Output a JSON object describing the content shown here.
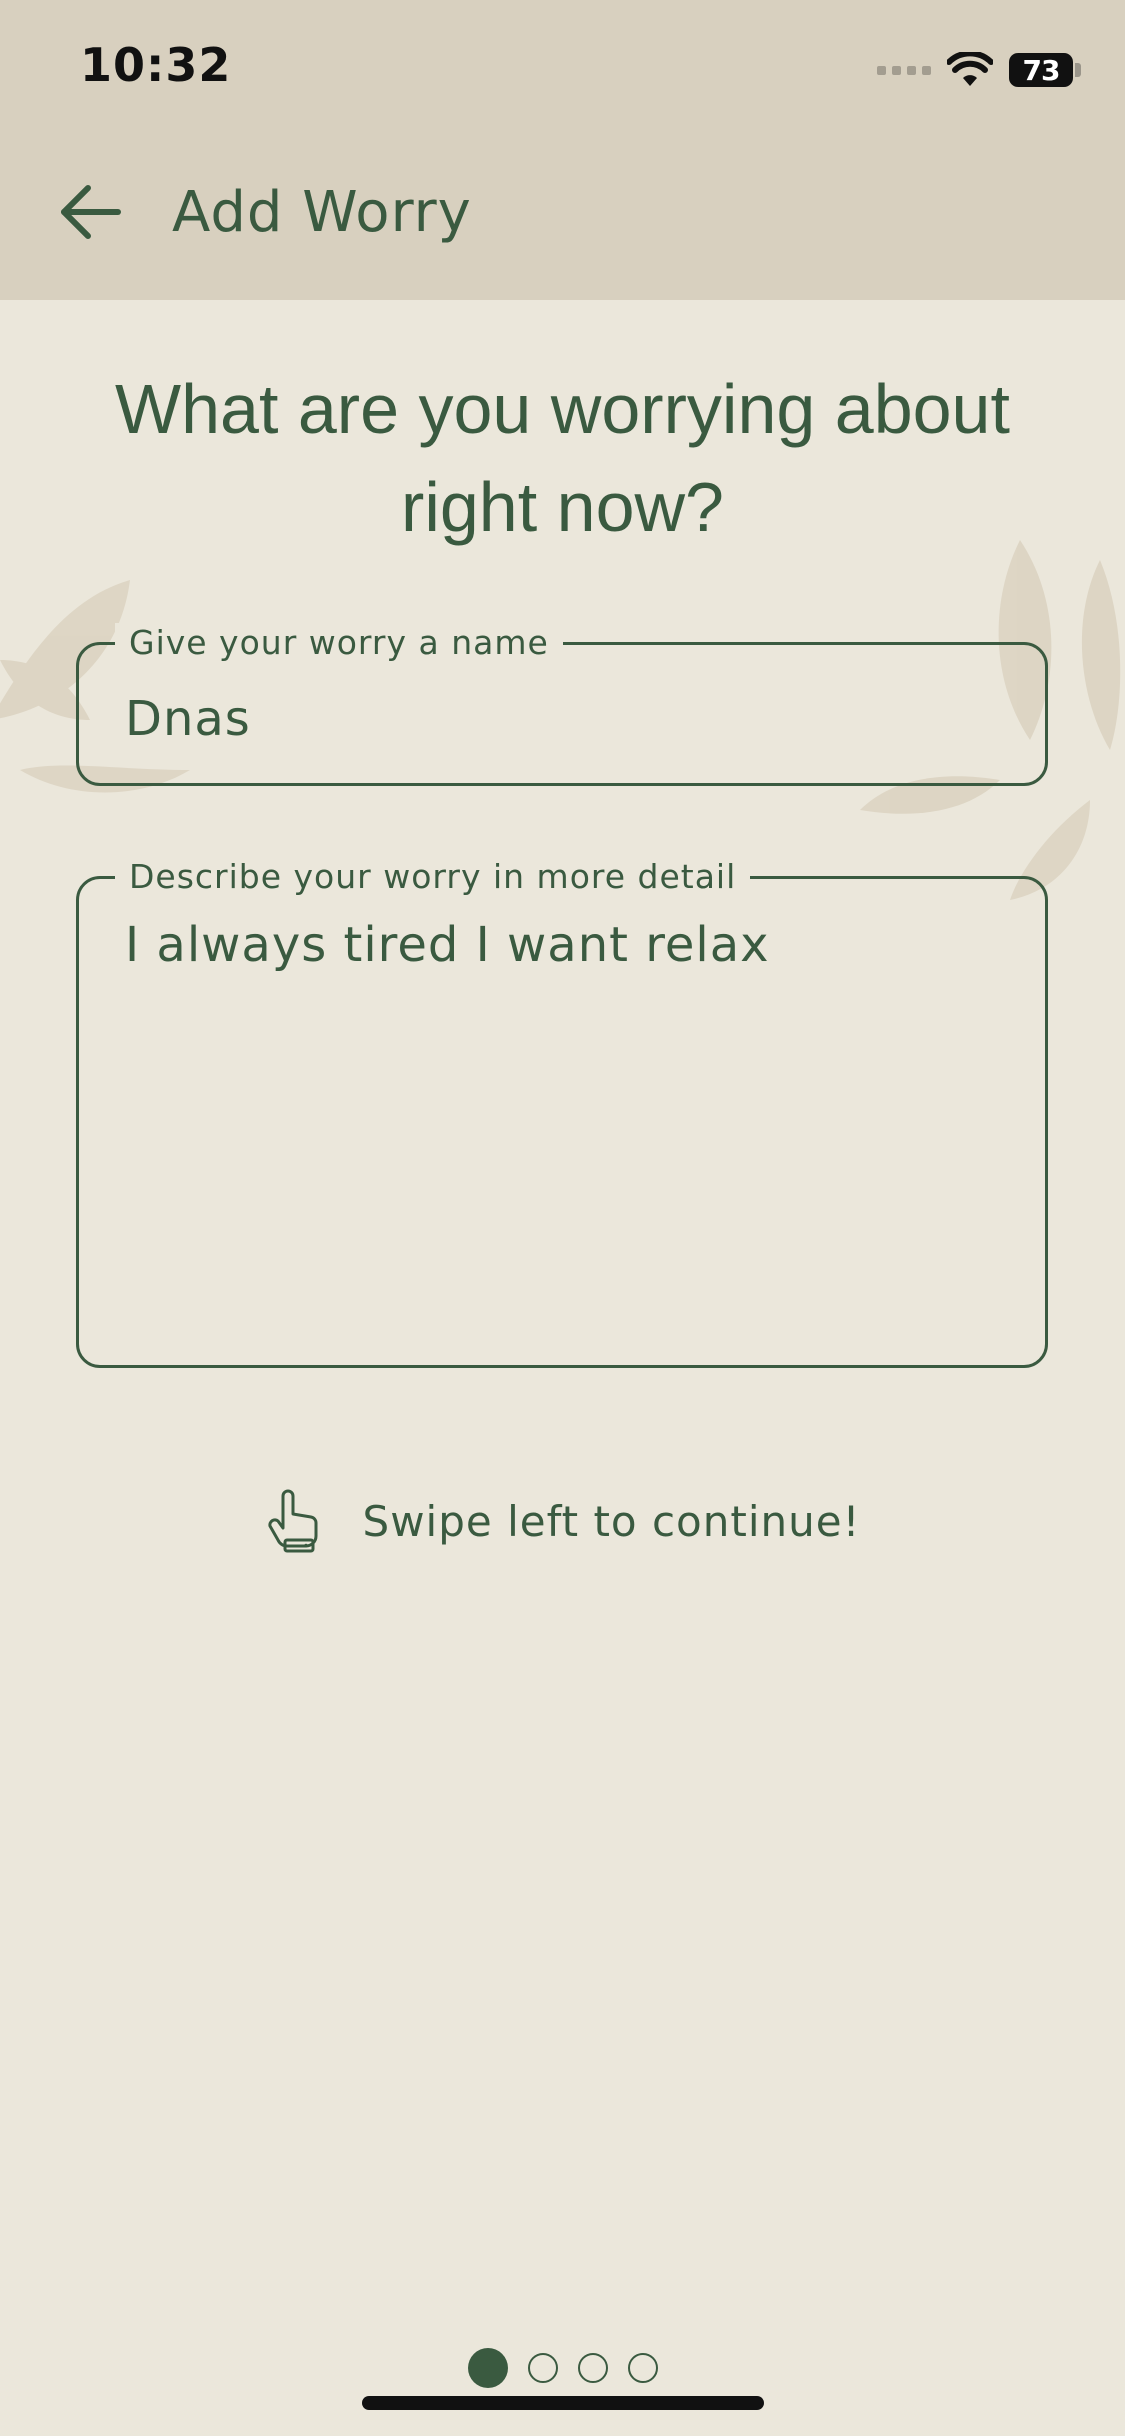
{
  "status_bar": {
    "time": "10:32",
    "battery": "73",
    "icons": [
      "signal-dots-icon",
      "wifi-icon",
      "battery-icon"
    ]
  },
  "header": {
    "title": "Add Worry",
    "back_icon": "arrow-left-icon"
  },
  "headline": "What are you worrying about right now?",
  "form": {
    "name_field": {
      "label": "Give your worry a name",
      "value": "Dnas"
    },
    "detail_field": {
      "label": "Describe your worry in more detail",
      "value": "I always tired I want relax"
    }
  },
  "swipe_hint": {
    "icon": "hand-pointer-icon",
    "text": "Swipe left to continue!"
  },
  "pagination": {
    "current_page": 1,
    "total_pages": 4
  },
  "colors": {
    "primary": "#3a5a40",
    "background": "#ebe7db",
    "header_background": "#d8d0bf"
  }
}
